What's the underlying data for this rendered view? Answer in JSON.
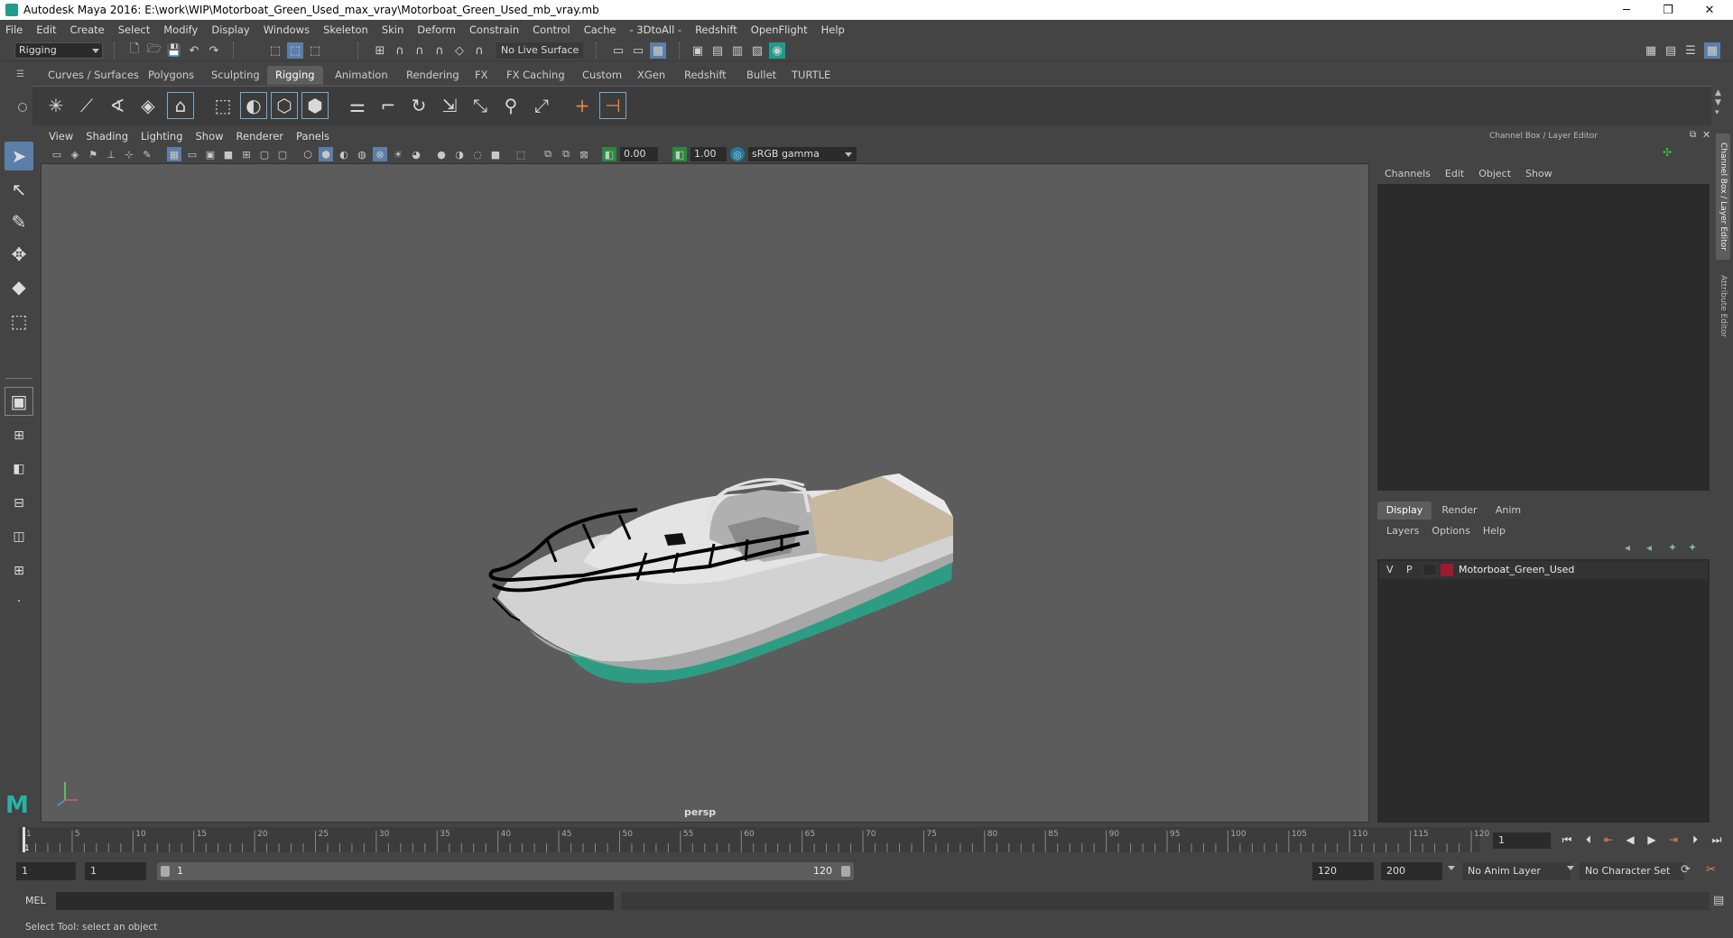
{
  "window": {
    "title": "Autodesk Maya 2016: E:\\work\\WIP\\Motorboat_Green_Used_max_vray\\Motorboat_Green_Used_mb_vray.mb",
    "minimize": "─",
    "restore": "❐",
    "close": "✕"
  },
  "menubar": [
    "File",
    "Edit",
    "Create",
    "Select",
    "Modify",
    "Display",
    "Windows",
    "Skeleton",
    "Skin",
    "Deform",
    "Constrain",
    "Control",
    "Cache",
    "- 3DtoAll -",
    "Redshift",
    "OpenFlight",
    "Help"
  ],
  "statusline": {
    "mode": "Rigging",
    "live_surface": "No Live Surface"
  },
  "shelf_tabs": [
    "Curves / Surfaces",
    "Polygons",
    "Sculpting",
    "Rigging",
    "Animation",
    "Rendering",
    "FX",
    "FX Caching",
    "Custom",
    "XGen",
    "Redshift",
    "Bullet",
    "TURTLE"
  ],
  "active_shelf_tab": "Rigging",
  "viewport": {
    "menu": [
      "View",
      "Shading",
      "Lighting",
      "Show",
      "Renderer",
      "Panels"
    ],
    "exposure": "0.00",
    "gamma": "1.00",
    "color_space": "sRGB gamma",
    "camera_label": "persp"
  },
  "channel_box": {
    "title": "Channel Box / Layer Editor",
    "menu": [
      "Channels",
      "Edit",
      "Object",
      "Show"
    ]
  },
  "layer_editor": {
    "tabs": [
      "Display",
      "Render",
      "Anim"
    ],
    "active_tab": "Display",
    "menu": [
      "Layers",
      "Options",
      "Help"
    ],
    "layers": [
      {
        "visible": "V",
        "playback": "P",
        "name": "Motorboat_Green_Used",
        "color": "#9b1b30"
      }
    ]
  },
  "side_tabs": [
    "Channel Box / Layer Editor",
    "Attribute Editor"
  ],
  "timeline": {
    "ticks": [
      1,
      5,
      10,
      15,
      20,
      25,
      30,
      35,
      40,
      45,
      50,
      55,
      60,
      65,
      70,
      75,
      80,
      85,
      90,
      95,
      100,
      105,
      110,
      115,
      120
    ],
    "start": 1,
    "end": 120,
    "current_frame": "1"
  },
  "range": {
    "start_time": "1",
    "playback_start": "1",
    "slider_start": "1",
    "slider_end": "120",
    "playback_end": "120",
    "end_time": "200",
    "anim_layer": "No Anim Layer",
    "character_set": "No Character Set"
  },
  "command_line": {
    "label": "MEL"
  },
  "help_line": "Select Tool: select an object",
  "colors": {
    "accent": "#5b7fa8",
    "hull_green": "#2e9c84",
    "layer_color": "#9b1b30"
  }
}
